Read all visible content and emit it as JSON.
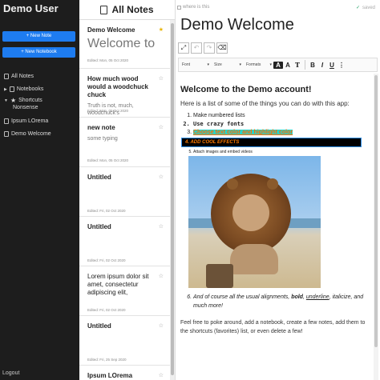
{
  "sidebar": {
    "user": "Demo User",
    "new_note": "+ New Note",
    "new_notebook": "+ New Notebook",
    "all_notes": "All Notes",
    "notebooks": "Notebooks",
    "shortcuts": "Shortcuts",
    "shortcut_items": [
      "Nonsense",
      "Ipsum LOrema",
      "Demo Welcome"
    ],
    "logout": "Logout"
  },
  "notes": {
    "header": "All Notes",
    "items": [
      {
        "title": "Demo Welcome",
        "big": "Welcome to",
        "excerpt": "",
        "edited": "Edited: Mon, 05 Oct 2020",
        "starred": true
      },
      {
        "title": "How much wood would a woodchuck chuck",
        "big": "",
        "excerpt": "Truth is not, much, woodchuck's",
        "edited": "Edited: Mon, 05 Oct 2020",
        "starred": false
      },
      {
        "title": "new note",
        "big": "",
        "excerpt": "some typing",
        "edited": "Edited: Mon, 05 Oct 2020",
        "starred": false
      },
      {
        "title": "Untitled",
        "big": "",
        "excerpt": "",
        "edited": "Edited: Fri, 02 Oct 2020",
        "starred": false
      },
      {
        "title": "Untitled",
        "big": "",
        "excerpt": "",
        "edited": "Edited: Fri, 02 Oct 2020",
        "starred": false
      },
      {
        "title": "Lorem ipsum dolor sit amet, consectetur adipiscing elit,",
        "big": "",
        "excerpt": "",
        "edited": "Edited: Fri, 02 Oct 2020",
        "starred": false
      },
      {
        "title": "Untitled",
        "big": "",
        "excerpt": "",
        "edited": "Edited: Fri, 25 Sep 2020",
        "starred": false
      },
      {
        "title": "Ipsum LOrema",
        "big": "",
        "excerpt": "",
        "edited": "",
        "starred": false
      }
    ]
  },
  "editor": {
    "shortcut_label": "where is this",
    "saved": "saved",
    "title": "Demo Welcome",
    "toolbar": {
      "font": "Font",
      "size": "Size",
      "formats": "Formats"
    },
    "heading": "Welcome to the Demo account!",
    "intro": "Here is a list of some of the things you can do with this app:",
    "list": {
      "item1": "Make numbered lists",
      "item2": "Use crazy fonts",
      "item3": "Choose text color and highlight color",
      "item4": "4. ADD COOL EFFECTS",
      "item5": "Attach images and embed videos"
    },
    "item6_pre": "And of course all the usual alignments, ",
    "item6_bold": "bold",
    "item6_mid": ", ",
    "item6_underline": "underline",
    "item6_mid2": ", ",
    "item6_italic": "italicize",
    "item6_post": ", and much more!",
    "outro": "Feel free to poke around, add a notebook, create a few notes, add them to the shortcuts (favorites) list, or even delete a few!"
  }
}
